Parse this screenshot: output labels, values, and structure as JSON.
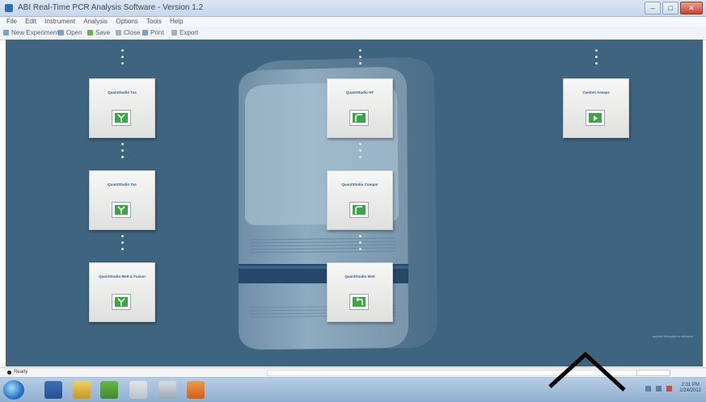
{
  "window": {
    "title": "ABI Real-Time PCR Analysis Software - Version 1.2",
    "controls": [
      "–",
      "□",
      "✕"
    ]
  },
  "menubar": [
    "File",
    "Edit",
    "Instrument",
    "Analysis",
    "Options",
    "Tools",
    "Help"
  ],
  "toolbar": [
    "New Experiment",
    "Open",
    "Save",
    "Close",
    "Print",
    "Export"
  ],
  "workflow": {
    "tiles": [
      {
        "id": "tile-1",
        "label": "QuantStudio Tas",
        "icon": "green-split-icon"
      },
      {
        "id": "tile-2",
        "label": "QuantStudio Tas",
        "icon": "green-split-icon"
      },
      {
        "id": "tile-3",
        "label": "QuantStudio Melt & Fusion",
        "icon": "green-split-icon"
      },
      {
        "id": "tile-4",
        "label": "QuantStudio HT",
        "icon": "green-curve-icon"
      },
      {
        "id": "tile-5",
        "label": "QuantStudio Compar",
        "icon": "green-curve-icon"
      },
      {
        "id": "tile-6",
        "label": "QuantStudio Melt",
        "icon": "green-return-icon"
      },
      {
        "id": "tile-7",
        "label": "Custom Assays",
        "icon": "green-play-icon"
      }
    ],
    "note": "applied biosystems software"
  },
  "statusbar": {
    "status": "Ready"
  },
  "taskbar": {
    "clock_time": "2:31 PM",
    "clock_date": "1/24/2012"
  },
  "colors": {
    "canvas": "#3e6480",
    "tile_label": "#2c5b8f",
    "tile_icon": "#3da548"
  }
}
